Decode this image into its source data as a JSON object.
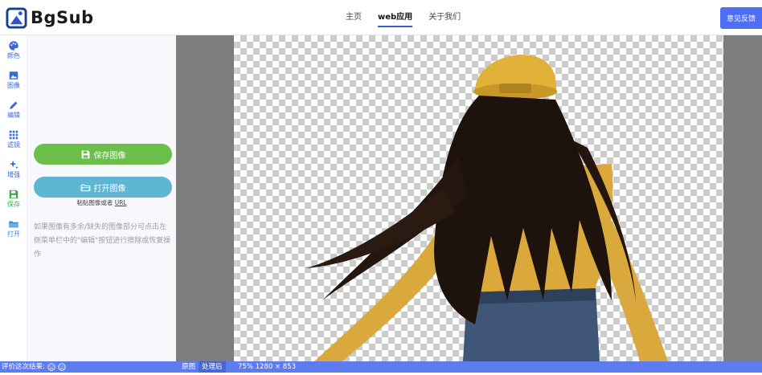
{
  "header": {
    "logo_text": "BgSub",
    "nav": [
      {
        "label": "主页",
        "active": false
      },
      {
        "label": "web应用",
        "active": true
      },
      {
        "label": "关于我们",
        "active": false
      }
    ],
    "feedback_label": "意见反馈"
  },
  "rail": {
    "items": [
      {
        "label": "颜色",
        "icon": "palette-icon"
      },
      {
        "label": "图像",
        "icon": "image-icon"
      },
      {
        "label": "编辑",
        "icon": "pencil-icon"
      },
      {
        "label": "滤镜",
        "icon": "filter-icon"
      },
      {
        "label": "增强",
        "icon": "sparkle-icon"
      },
      {
        "label": "保存",
        "icon": "save-icon"
      },
      {
        "label": "打开",
        "icon": "folder-icon"
      }
    ]
  },
  "panel": {
    "save_label": "保存图像",
    "open_label": "打开图像",
    "paste_hint_prefix": "粘贴图像或者",
    "paste_hint_url": "URL",
    "tip": "如果图像有多余/缺失的图像部分可点击左侧菜单栏中的\"编辑\"按钮进行擦除或恢复操作"
  },
  "statusbar": {
    "rate_label": "评价这次结果:",
    "tab_original": "原图",
    "tab_processed": "处理后",
    "zoom_info": "75% 1280 × 853"
  },
  "colors": {
    "accent": "#4f6ef7",
    "save_button": "#6cbf4a",
    "open_button": "#5fb6d3",
    "statusbar": "#5c7cf0"
  }
}
